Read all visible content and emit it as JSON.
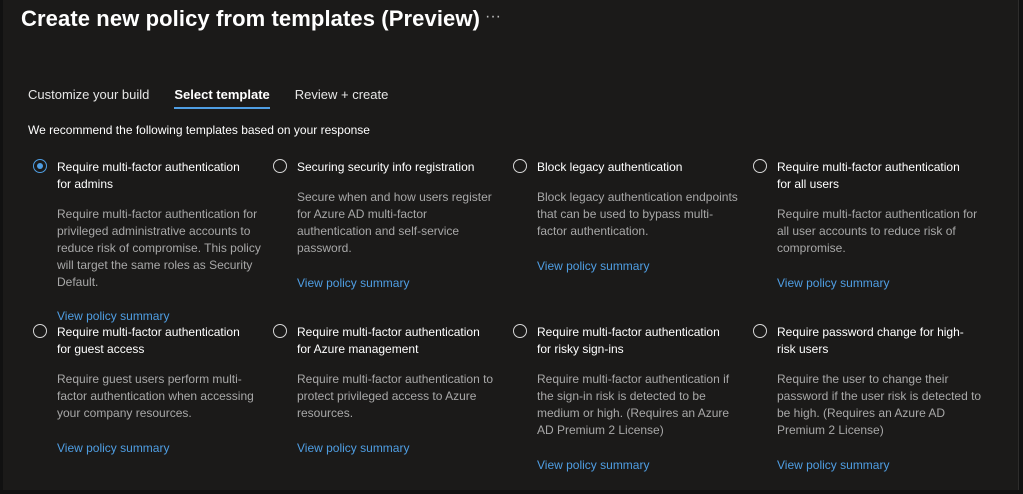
{
  "header": {
    "title": "Create new policy from templates (Preview)",
    "more_icon": "more-horizontal-icon",
    "more_label": "···"
  },
  "tabs": [
    {
      "label": "Customize your build",
      "active": false
    },
    {
      "label": "Select template",
      "active": true
    },
    {
      "label": "Review + create",
      "active": false
    }
  ],
  "subtitle": "We recommend the following templates based on your response",
  "colors": {
    "accent": "#4f9ee3",
    "background": "#1b1a19",
    "description": "#a8a8a8"
  },
  "templates": [
    {
      "title": "Require multi-factor authentication for admins",
      "description": "Require multi-factor authentication for privileged administrative accounts to reduce risk of compromise. This policy will target the same roles as Security Default.",
      "link": "View policy summary",
      "selected": true
    },
    {
      "title": "Securing security info registration",
      "description": "Secure when and how users register for Azure AD multi-factor authentication and self-service password.",
      "link": "View policy summary",
      "selected": false
    },
    {
      "title": "Block legacy authentication",
      "description": "Block legacy authentication endpoints that can be used to bypass multi-factor authentication.",
      "link": "View policy summary",
      "selected": false
    },
    {
      "title": "Require multi-factor authentication for all users",
      "description": "Require multi-factor authentication for all user accounts to reduce risk of compromise.",
      "link": "View policy summary",
      "selected": false
    },
    {
      "title": "Require multi-factor authentication for guest access",
      "description": "Require guest users perform multi-factor authentication when accessing your company resources.",
      "link": "View policy summary",
      "selected": false
    },
    {
      "title": "Require multi-factor authentication for Azure management",
      "description": "Require multi-factor authentication to protect privileged access to Azure resources.",
      "link": "View policy summary",
      "selected": false
    },
    {
      "title": "Require multi-factor authentication for risky sign-ins",
      "description": "Require multi-factor authentication if the sign-in risk is detected to be medium or high. (Requires an Azure AD Premium 2 License)",
      "link": "View policy summary",
      "selected": false
    },
    {
      "title": "Require password change for high-risk users",
      "description": "Require the user to change their password if the user risk is detected to be high. (Requires an Azure AD Premium 2 License)",
      "link": "View policy summary",
      "selected": false
    }
  ]
}
